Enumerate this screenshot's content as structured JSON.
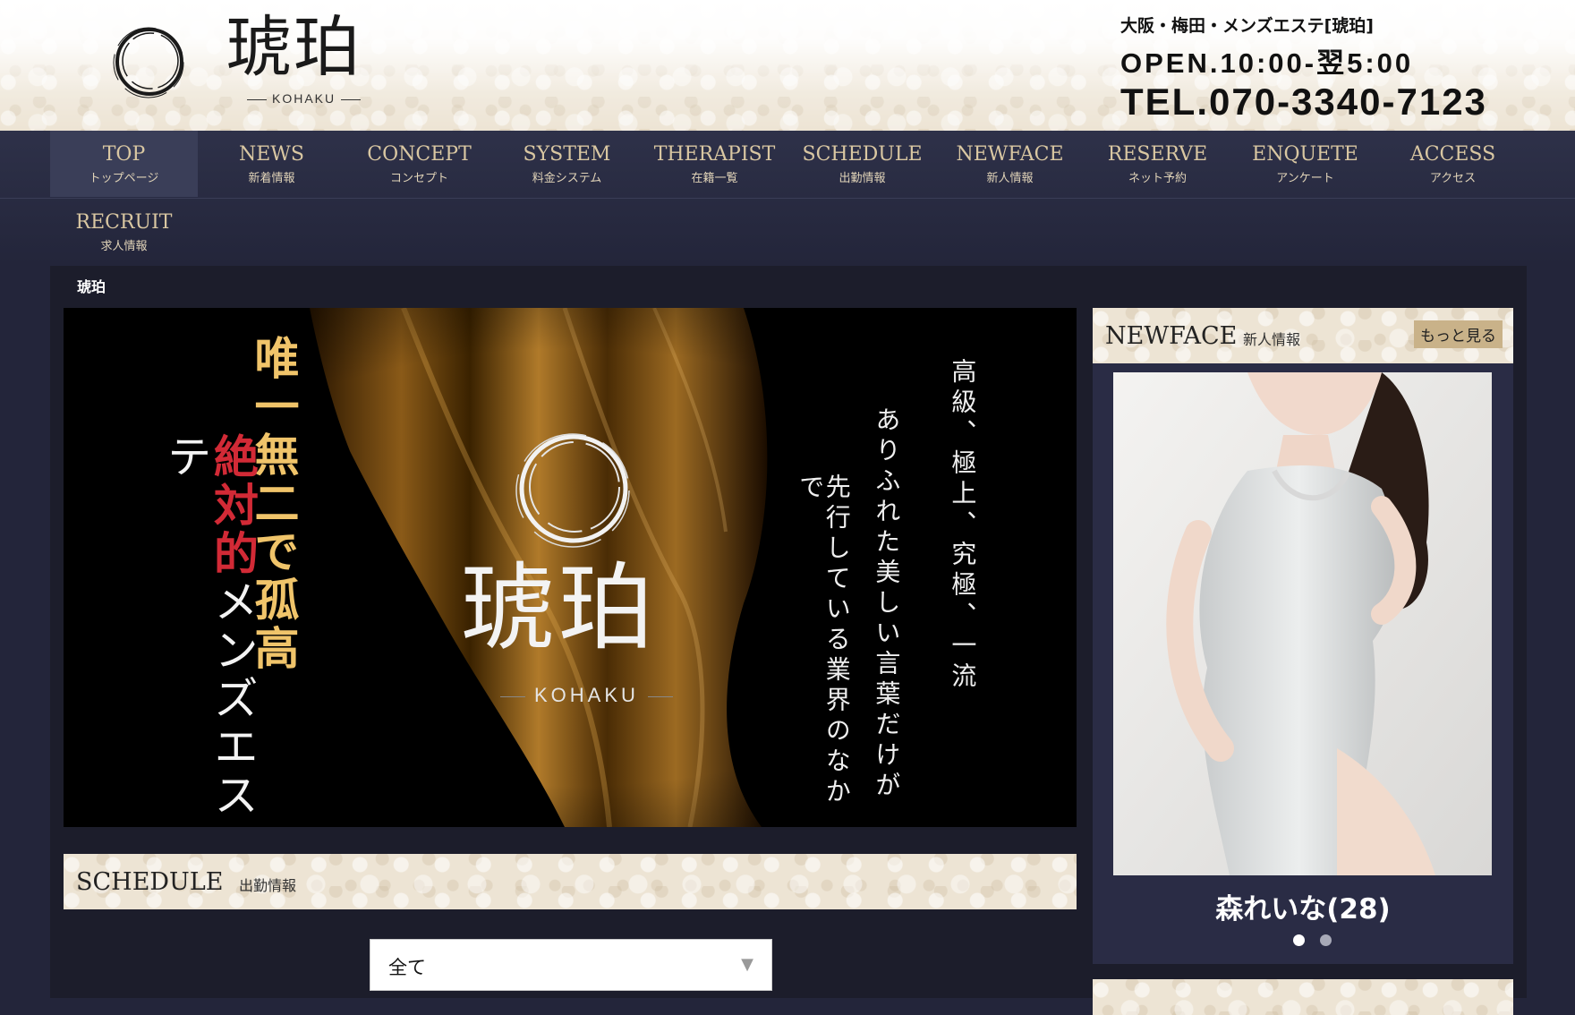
{
  "header": {
    "logo_kanji": "琥珀",
    "logo_roman": "KOHAKU",
    "area": "大阪・梅田・メンズエステ[琥珀]",
    "hours": "OPEN.10:00-翌5:00",
    "tel": "TEL.070-3340-7123"
  },
  "nav": [
    {
      "en": "TOP",
      "jp": "トップページ"
    },
    {
      "en": "NEWS",
      "jp": "新着情報"
    },
    {
      "en": "CONCEPT",
      "jp": "コンセプト"
    },
    {
      "en": "SYSTEM",
      "jp": "料金システム"
    },
    {
      "en": "THERAPIST",
      "jp": "在籍一覧"
    },
    {
      "en": "SCHEDULE",
      "jp": "出勤情報"
    },
    {
      "en": "NEWFACE",
      "jp": "新人情報"
    },
    {
      "en": "RESERVE",
      "jp": "ネット予約"
    },
    {
      "en": "ENQUETE",
      "jp": "アンケート"
    },
    {
      "en": "ACCESS",
      "jp": "アクセス"
    },
    {
      "en": "RECRUIT",
      "jp": "求人情報"
    }
  ],
  "breadcrumb": "琥珀",
  "hero": {
    "uni_a": "唯一無二で",
    "uni_b": "孤高",
    "zettai_a": "絶対的",
    "zettai_b": "メンズエステ",
    "line1": "高級、極上、究極、一流",
    "line2": "ありふれた美しい言葉だけが",
    "line3": "先行している業界のなかで",
    "logo_kanji": "琥珀",
    "logo_roman": "KOHAKU"
  },
  "schedule": {
    "title_en": "SCHEDULE",
    "title_jp": "出勤情報",
    "filter_value": "全て"
  },
  "newface": {
    "title_en": "NEWFACE",
    "title_jp": "新人情報",
    "more_label": "もっと見る",
    "name": "森れいな(28)"
  }
}
